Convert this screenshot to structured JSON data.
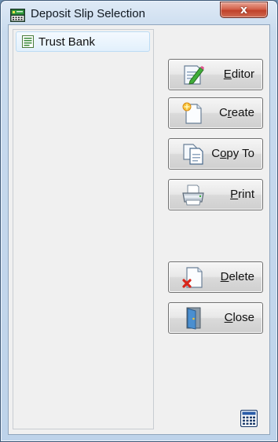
{
  "window": {
    "title": "Deposit Slip Selection",
    "close_glyph": "x"
  },
  "list": {
    "items": [
      {
        "label": "Trust Bank",
        "icon": "document-icon",
        "selected": true
      }
    ]
  },
  "buttons": [
    {
      "id": "editor",
      "label": "Editor",
      "mnemonic": "E",
      "icon": "pencil-document-icon"
    },
    {
      "id": "create",
      "label": "Create",
      "mnemonic": "r",
      "icon": "new-document-icon"
    },
    {
      "id": "copy-to",
      "label": "Copy To",
      "mnemonic": "o",
      "icon": "copy-documents-icon"
    },
    {
      "id": "print",
      "label": "Print",
      "mnemonic": "P",
      "icon": "printer-icon"
    },
    {
      "id": "delete",
      "label": "Delete",
      "mnemonic": "D",
      "icon": "delete-document-icon"
    },
    {
      "id": "close",
      "label": "Close",
      "mnemonic": "C",
      "icon": "door-icon"
    }
  ],
  "footer": {
    "icon": "calculator-icon"
  },
  "colors": {
    "title_bar": "#c9dbee",
    "close_button": "#c0422a",
    "selection": "#e2f0fc"
  }
}
